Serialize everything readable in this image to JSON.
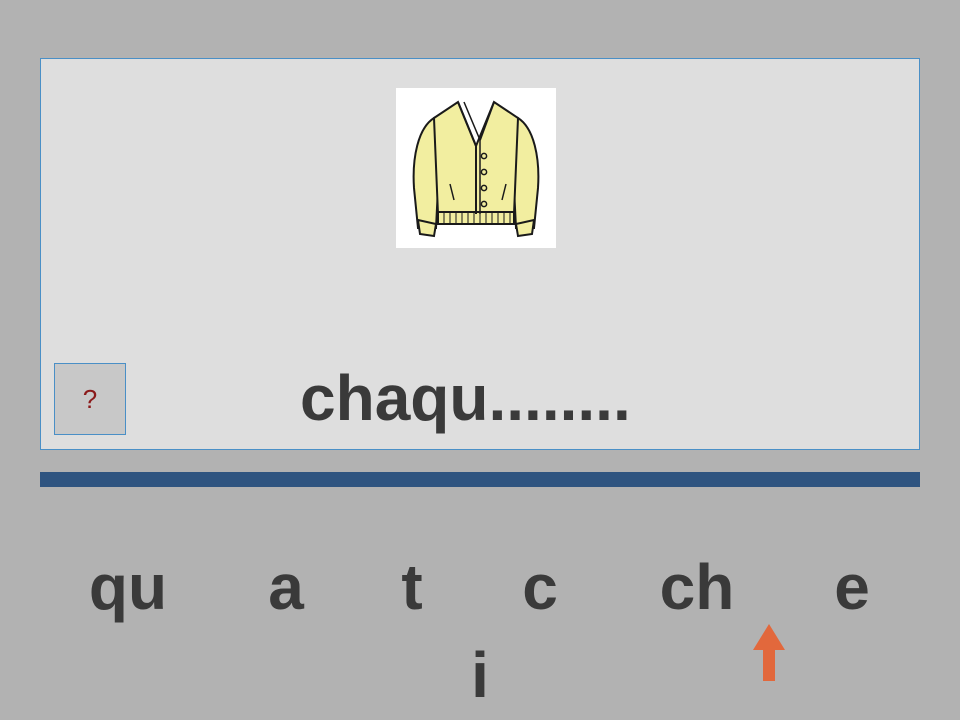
{
  "exercise": {
    "word": "chaqu........",
    "help_label": "?",
    "picture_icon": "cardigan-sweater-icon"
  },
  "choices": [
    "qu",
    "a",
    "t",
    "c",
    "ch",
    "e",
    "i"
  ],
  "pointer": {
    "icon": "up-arrow-icon",
    "points_to": "e"
  },
  "colors": {
    "background": "#b2b2b2",
    "panel": "#dedede",
    "panel_border": "#4a8fc6",
    "divider": "#2f5480",
    "text": "#3a3a3a",
    "help_mark": "#8b1a1a",
    "arrow": "#e2683c",
    "sweater": "#f2eea0"
  }
}
